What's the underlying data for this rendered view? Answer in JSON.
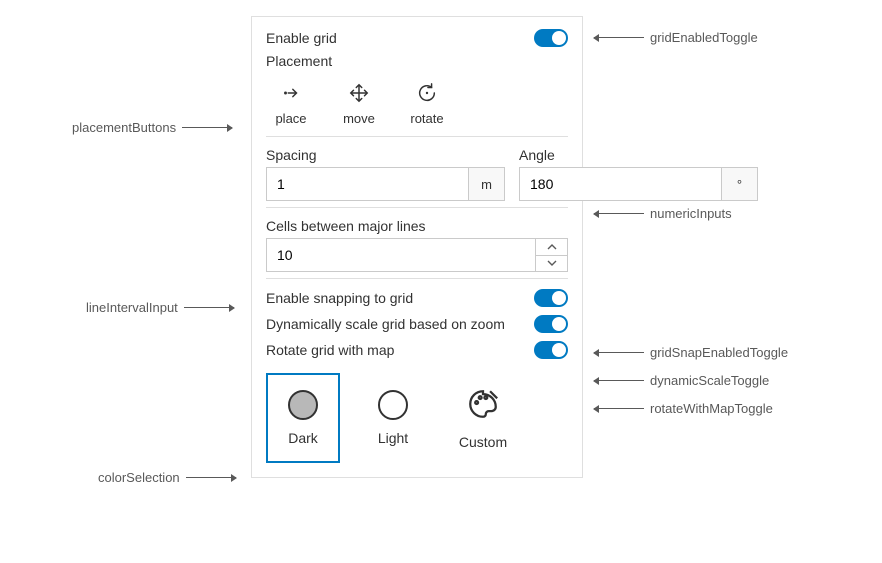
{
  "panel": {
    "enableGrid": {
      "label": "Enable grid",
      "on": true
    },
    "placement": {
      "label": "Placement",
      "buttons": [
        {
          "name": "place",
          "label": "place"
        },
        {
          "name": "move",
          "label": "move"
        },
        {
          "name": "rotate",
          "label": "rotate"
        }
      ]
    },
    "spacing": {
      "label": "Spacing",
      "value": "1",
      "unit": "m"
    },
    "angle": {
      "label": "Angle",
      "value": "180",
      "unit": "°"
    },
    "cells": {
      "label": "Cells between major lines",
      "value": "10"
    },
    "snap": {
      "label": "Enable snapping to grid",
      "on": true
    },
    "dynamicScale": {
      "label": "Dynamically scale grid based on zoom",
      "on": true
    },
    "rotateWithMap": {
      "label": "Rotate grid with map",
      "on": true
    },
    "colors": {
      "options": [
        {
          "name": "dark",
          "label": "Dark",
          "selected": true
        },
        {
          "name": "light",
          "label": "Light",
          "selected": false
        },
        {
          "name": "custom",
          "label": "Custom",
          "selected": false
        }
      ]
    }
  },
  "annotations": {
    "gridEnabledToggle": "gridEnabledToggle",
    "placementButtons": "placementButtons",
    "numericInputs": "numericInputs",
    "lineIntervalInput": "lineIntervalInput",
    "gridSnapEnabledToggle": "gridSnapEnabledToggle",
    "dynamicScaleToggle": "dynamicScaleToggle",
    "rotateWithMapToggle": "rotateWithMapToggle",
    "colorSelection": "colorSelection"
  }
}
